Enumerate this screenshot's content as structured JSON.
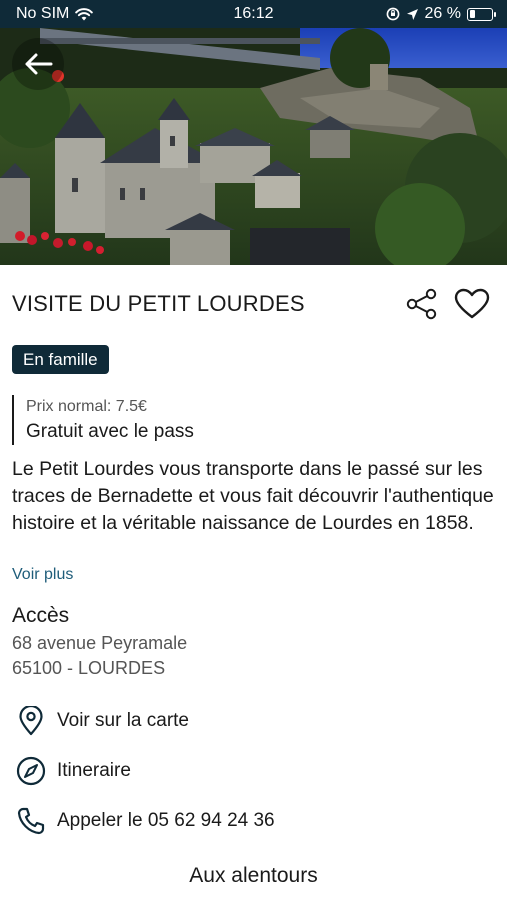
{
  "status_bar": {
    "carrier": "No SIM",
    "time": "16:12",
    "battery_percent": "26 %",
    "battery_level": 0.26
  },
  "header": {
    "back_icon": "arrow-left-icon"
  },
  "event": {
    "title": "VISITE DU PETIT LOURDES",
    "category_badge": "En famille",
    "price_normal": "Prix normal: 7.5€",
    "price_pass": "Gratuit avec le pass",
    "description": "Le Petit Lourdes vous transporte dans le passé sur les traces de Bernadette et vous fait découvrir l'authentique histoire et la véritable naissance de Lourdes en 1858.",
    "see_more": "Voir plus"
  },
  "access": {
    "title": "Accès",
    "address_line1": "68 avenue Peyramale",
    "address_line2": "65100 - LOURDES"
  },
  "actions": [
    {
      "label": "Voir sur la carte",
      "icon": "map-pin-icon"
    },
    {
      "label": "Itineraire",
      "icon": "compass-icon"
    },
    {
      "label": "Appeler le 05 62 94 24 36",
      "icon": "phone-icon"
    }
  ],
  "nearby_title": "Aux alentours",
  "colors": {
    "primary": "#0f2a38",
    "link": "#1f5d7a",
    "text": "#1a1a1a"
  }
}
